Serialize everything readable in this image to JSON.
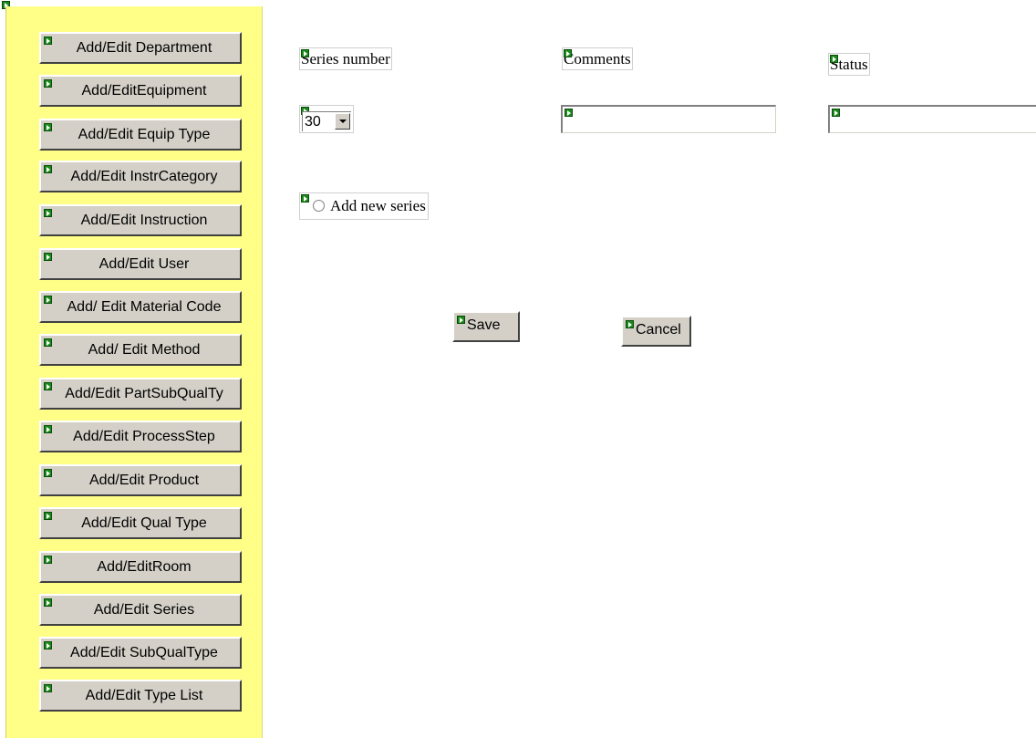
{
  "sidebar": {
    "buttons": [
      "Add/Edit Department",
      "Add/EditEquipment",
      "Add/Edit Equip Type",
      "Add/Edit InstrCategory",
      "Add/Edit Instruction",
      "Add/Edit User",
      "Add/ Edit Material Code",
      "Add/ Edit Method",
      "Add/Edit PartSubQualTy",
      "Add/Edit ProcessStep",
      "Add/Edit Product",
      "Add/Edit Qual Type",
      "Add/EditRoom",
      "Add/Edit Series",
      "Add/Edit SubQualType",
      "Add/Edit Type List"
    ]
  },
  "form": {
    "series_number_label": "Series number",
    "comments_label": "Comments",
    "status_label": "Status",
    "series_number_value": "30",
    "comments_value": "",
    "status_value": "",
    "add_new_series_label": "Add new series",
    "save_label": "Save",
    "cancel_label": "Cancel"
  },
  "colors": {
    "sidebar_background": "#ffff88",
    "button_face": "#d4d0c8",
    "marker_green": "#1a8a1a"
  }
}
